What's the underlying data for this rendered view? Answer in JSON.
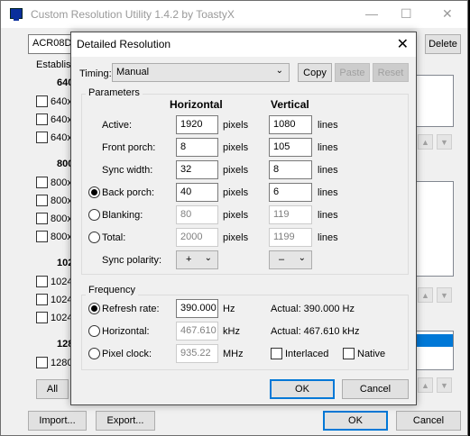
{
  "main": {
    "title": "Custom Resolution Utility 1.4.2 by ToastyX",
    "window_controls": [
      "—",
      "☐",
      "✕"
    ],
    "monitor": "ACR08DE",
    "delete_label": "Delete",
    "established_label": "Establish",
    "groups": [
      {
        "head": "640",
        "items": [
          "640x",
          "640x",
          "640x"
        ]
      },
      {
        "head": "800",
        "items": [
          "800x",
          "800x",
          "800x",
          "800x"
        ]
      },
      {
        "head": "102",
        "items": [
          "1024",
          "1024",
          "1024"
        ]
      },
      {
        "head": "128",
        "items": [
          "1280"
        ]
      }
    ],
    "all_label": "All",
    "import_label": "Import...",
    "export_label": "Export...",
    "ok_label": "OK",
    "cancel_label": "Cancel"
  },
  "dialog": {
    "title": "Detailed Resolution",
    "close_icon": "✕",
    "timing_label": "Timing:",
    "timing_value": "Manual",
    "copy_label": "Copy",
    "paste_label": "Paste",
    "reset_label": "Reset",
    "parameters_label": "Parameters",
    "horizontal_head": "Horizontal",
    "vertical_head": "Vertical",
    "rows": [
      {
        "label": "Active:",
        "h": "1920",
        "h_unit": "pixels",
        "v": "1080",
        "v_unit": "lines"
      },
      {
        "label": "Front porch:",
        "h": "8",
        "h_unit": "pixels",
        "v": "105",
        "v_unit": "lines"
      },
      {
        "label": "Sync width:",
        "h": "32",
        "h_unit": "pixels",
        "v": "8",
        "v_unit": "lines"
      },
      {
        "label": "Back porch:",
        "h": "40",
        "h_unit": "pixels",
        "v": "6",
        "v_unit": "lines"
      },
      {
        "label": "Blanking:",
        "h": "80",
        "h_unit": "pixels",
        "v": "119",
        "v_unit": "lines"
      },
      {
        "label": "Total:",
        "h": "2000",
        "h_unit": "pixels",
        "v": "1199",
        "v_unit": "lines"
      }
    ],
    "sync_polarity_label": "Sync polarity:",
    "h_polarity": "+",
    "v_polarity": "–",
    "frequency_label": "Frequency",
    "refresh_label": "Refresh rate:",
    "refresh_value": "390.000",
    "refresh_unit": "Hz",
    "refresh_actual": "Actual: 390.000 Hz",
    "horizontal_label": "Horizontal:",
    "horizontal_value": "467.610",
    "horizontal_unit": "kHz",
    "horizontal_actual": "Actual: 467.610 kHz",
    "pixel_clock_label": "Pixel clock:",
    "pixel_clock_value": "935.22",
    "pixel_clock_unit": "MHz",
    "interlaced_label": "Interlaced",
    "native_label": "Native",
    "ok_label": "OK",
    "cancel_label": "Cancel"
  }
}
